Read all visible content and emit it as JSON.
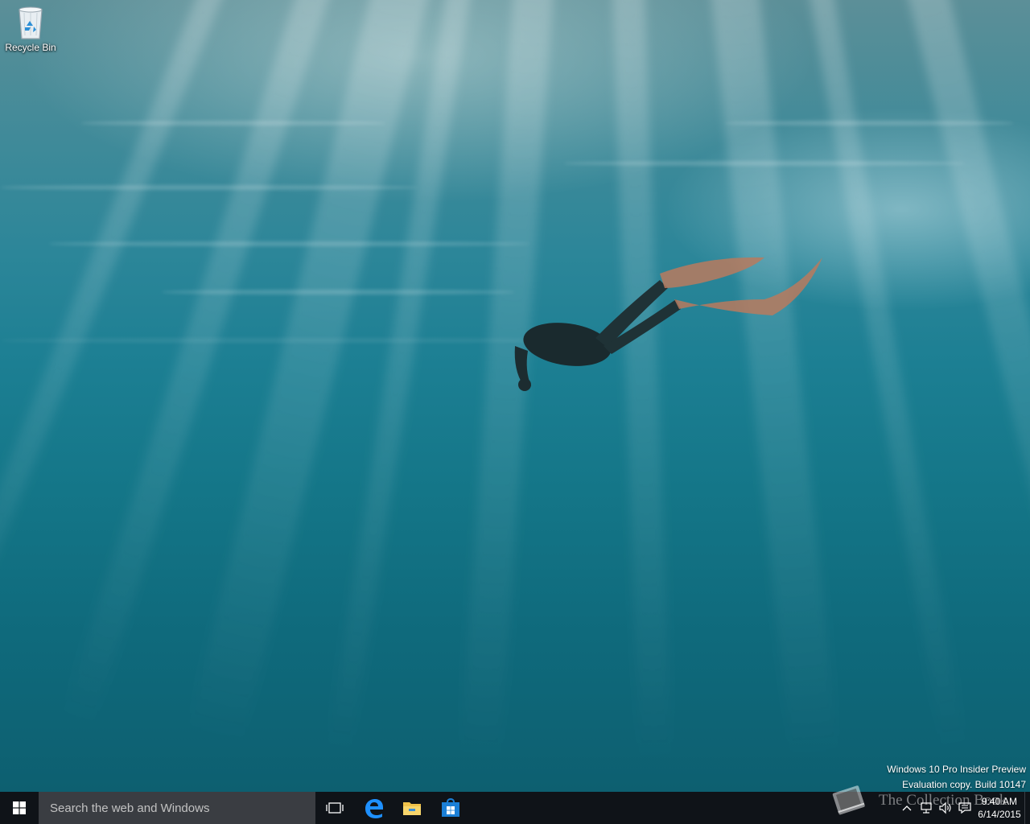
{
  "desktop": {
    "icons": [
      {
        "label": "Recycle Bin",
        "icon": "recycle-bin-icon"
      }
    ],
    "watermark": {
      "line1": "Windows 10 Pro Insider Preview",
      "line2": "Evaluation copy. Build 10147"
    },
    "overlay_logo": {
      "text": "The Collection Book",
      "icon": "book-icon"
    }
  },
  "taskbar": {
    "start_icon": "windows-logo-icon",
    "search": {
      "placeholder": "Search the web and Windows",
      "value": ""
    },
    "pinned": [
      {
        "name": "task-view",
        "icon": "task-view-icon"
      },
      {
        "name": "edge",
        "icon": "edge-icon"
      },
      {
        "name": "file-explorer",
        "icon": "folder-icon"
      },
      {
        "name": "store",
        "icon": "store-icon"
      }
    ],
    "tray": {
      "icons": [
        "chevron-up-icon",
        "network-icon",
        "volume-icon",
        "action-center-icon"
      ],
      "time": "9:40 AM",
      "date": "6/14/2015"
    }
  },
  "colors": {
    "taskbar_bg": "#0f1318",
    "search_bg": "#3a3d42",
    "accent": "#0078d7"
  }
}
